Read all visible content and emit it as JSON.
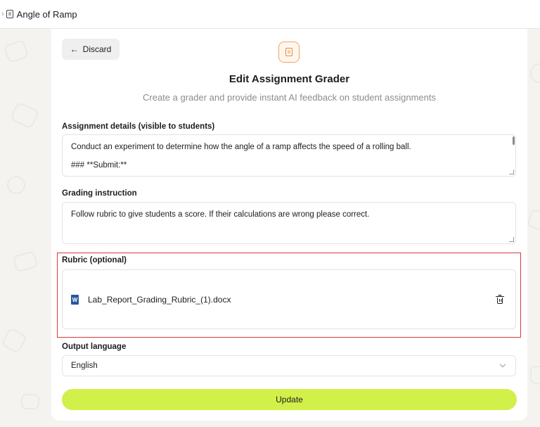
{
  "breadcrumb": {
    "chevron": "›",
    "icon": "document-icon",
    "title": "Angle of Ramp"
  },
  "toolbar": {
    "discard_arrow": "←",
    "discard_label": "Discard"
  },
  "header": {
    "icon": "document-icon",
    "icon_color": "#e8893b",
    "title": "Edit Assignment Grader",
    "subtitle": "Create a grader and provide instant AI feedback on student assignments"
  },
  "assignment_details": {
    "label": "Assignment details (visible to students)",
    "line1": "Conduct an experiment to determine how the angle of a ramp affects the speed of a rolling ball.",
    "line2": "### **Submit:**"
  },
  "grading_instruction": {
    "label": "Grading instruction",
    "value": "Follow rubric to give students a score. If their calculations are wrong please correct."
  },
  "rubric": {
    "label": "Rubric (optional)",
    "file_name": "Lab_Report_Grading_Rubric_(1).docx",
    "file_icon": "word-doc-icon",
    "delete_icon": "trash-icon",
    "highlight_color": "#d83a3a"
  },
  "output_language": {
    "label": "Output language",
    "value": "English"
  },
  "update_button": {
    "label": "Update",
    "color": "#d2f04a"
  }
}
